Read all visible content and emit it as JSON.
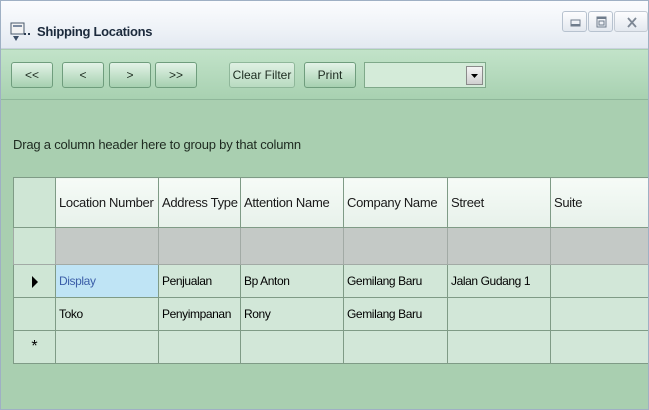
{
  "window": {
    "title": "Shipping Locations"
  },
  "toolbar": {
    "first_label": "<<",
    "prev_label": "<",
    "next_label": ">",
    "last_label": ">>",
    "clear_filter_label": "Clear Filter",
    "print_label": "Print",
    "dropdown_value": ""
  },
  "grid": {
    "group_hint": "Drag a column header here to group by that column",
    "columns": [
      "Location Number",
      "Address Type",
      "Attention Name",
      "Company Name",
      "Street",
      "Suite"
    ],
    "rows": [
      [
        "Display",
        "Penjualan",
        "Bp Anton",
        "Gemilang Baru",
        "Jalan Gudang 1",
        ""
      ],
      [
        "Toko",
        "Penyimpanan",
        "Rony",
        "Gemilang Baru",
        "",
        ""
      ]
    ],
    "new_row_marker": "*"
  },
  "colors": {
    "background": "#a9cfb0",
    "row_background": "#d2e7d8",
    "active_cell": "#bfe4f5",
    "filter_row": "#c4c9c6"
  },
  "icons": [
    "app-icon",
    "minimize-icon",
    "maximize-icon",
    "close-icon",
    "dropdown-arrow-icon",
    "row-pointer-icon"
  ]
}
